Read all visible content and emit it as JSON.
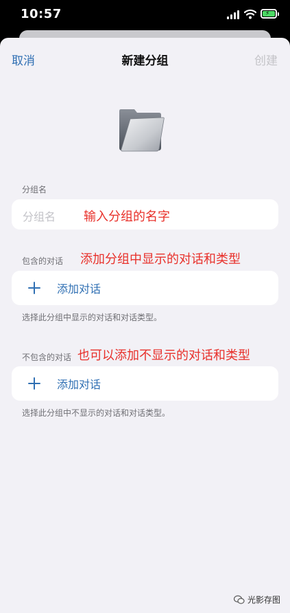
{
  "status_bar": {
    "time": "10:57"
  },
  "nav": {
    "cancel": "取消",
    "title": "新建分组",
    "create": "创建"
  },
  "group_name": {
    "section_label": "分组名",
    "placeholder": "分组名"
  },
  "included": {
    "section_label": "包含的对话",
    "add_label": "添加对话",
    "hint": "选择此分组中显示的对话和对话类型。"
  },
  "excluded": {
    "section_label": "不包含的对话",
    "add_label": "添加对话",
    "hint": "选择此分组中不显示的对话和对话类型。"
  },
  "annotations": {
    "name": "输入分组的名字",
    "include": "添加分组中显示的对话和类型",
    "exclude": "也可以添加不显示的对话和类型"
  },
  "watermark": "光影存图",
  "colors": {
    "accent": "#2f6fb3",
    "annotation": "#e8302a",
    "background": "#f2f1f6",
    "disabled": "#c4c4c8"
  },
  "icons": [
    "folder-icon",
    "plus-icon",
    "signal-icon",
    "wifi-icon",
    "battery-icon",
    "wechat-icon"
  ]
}
